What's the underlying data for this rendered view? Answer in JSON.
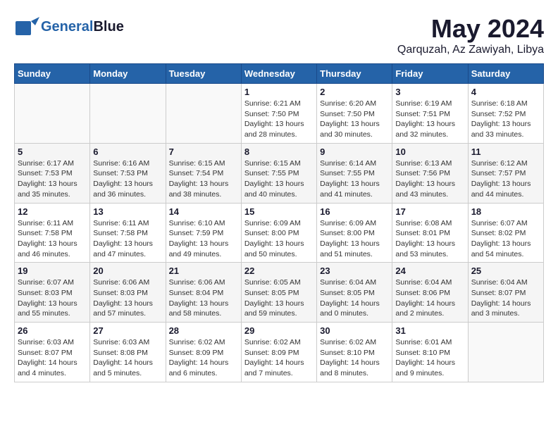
{
  "logo": {
    "part1": "General",
    "part2": "Blue"
  },
  "header": {
    "month": "May 2024",
    "location": "Qarquzah, Az Zawiyah, Libya"
  },
  "weekdays": [
    "Sunday",
    "Monday",
    "Tuesday",
    "Wednesday",
    "Thursday",
    "Friday",
    "Saturday"
  ],
  "weeks": [
    [
      {
        "day": "",
        "info": ""
      },
      {
        "day": "",
        "info": ""
      },
      {
        "day": "",
        "info": ""
      },
      {
        "day": "1",
        "info": "Sunrise: 6:21 AM\nSunset: 7:50 PM\nDaylight: 13 hours\nand 28 minutes."
      },
      {
        "day": "2",
        "info": "Sunrise: 6:20 AM\nSunset: 7:50 PM\nDaylight: 13 hours\nand 30 minutes."
      },
      {
        "day": "3",
        "info": "Sunrise: 6:19 AM\nSunset: 7:51 PM\nDaylight: 13 hours\nand 32 minutes."
      },
      {
        "day": "4",
        "info": "Sunrise: 6:18 AM\nSunset: 7:52 PM\nDaylight: 13 hours\nand 33 minutes."
      }
    ],
    [
      {
        "day": "5",
        "info": "Sunrise: 6:17 AM\nSunset: 7:53 PM\nDaylight: 13 hours\nand 35 minutes."
      },
      {
        "day": "6",
        "info": "Sunrise: 6:16 AM\nSunset: 7:53 PM\nDaylight: 13 hours\nand 36 minutes."
      },
      {
        "day": "7",
        "info": "Sunrise: 6:15 AM\nSunset: 7:54 PM\nDaylight: 13 hours\nand 38 minutes."
      },
      {
        "day": "8",
        "info": "Sunrise: 6:15 AM\nSunset: 7:55 PM\nDaylight: 13 hours\nand 40 minutes."
      },
      {
        "day": "9",
        "info": "Sunrise: 6:14 AM\nSunset: 7:55 PM\nDaylight: 13 hours\nand 41 minutes."
      },
      {
        "day": "10",
        "info": "Sunrise: 6:13 AM\nSunset: 7:56 PM\nDaylight: 13 hours\nand 43 minutes."
      },
      {
        "day": "11",
        "info": "Sunrise: 6:12 AM\nSunset: 7:57 PM\nDaylight: 13 hours\nand 44 minutes."
      }
    ],
    [
      {
        "day": "12",
        "info": "Sunrise: 6:11 AM\nSunset: 7:58 PM\nDaylight: 13 hours\nand 46 minutes."
      },
      {
        "day": "13",
        "info": "Sunrise: 6:11 AM\nSunset: 7:58 PM\nDaylight: 13 hours\nand 47 minutes."
      },
      {
        "day": "14",
        "info": "Sunrise: 6:10 AM\nSunset: 7:59 PM\nDaylight: 13 hours\nand 49 minutes."
      },
      {
        "day": "15",
        "info": "Sunrise: 6:09 AM\nSunset: 8:00 PM\nDaylight: 13 hours\nand 50 minutes."
      },
      {
        "day": "16",
        "info": "Sunrise: 6:09 AM\nSunset: 8:00 PM\nDaylight: 13 hours\nand 51 minutes."
      },
      {
        "day": "17",
        "info": "Sunrise: 6:08 AM\nSunset: 8:01 PM\nDaylight: 13 hours\nand 53 minutes."
      },
      {
        "day": "18",
        "info": "Sunrise: 6:07 AM\nSunset: 8:02 PM\nDaylight: 13 hours\nand 54 minutes."
      }
    ],
    [
      {
        "day": "19",
        "info": "Sunrise: 6:07 AM\nSunset: 8:03 PM\nDaylight: 13 hours\nand 55 minutes."
      },
      {
        "day": "20",
        "info": "Sunrise: 6:06 AM\nSunset: 8:03 PM\nDaylight: 13 hours\nand 57 minutes."
      },
      {
        "day": "21",
        "info": "Sunrise: 6:06 AM\nSunset: 8:04 PM\nDaylight: 13 hours\nand 58 minutes."
      },
      {
        "day": "22",
        "info": "Sunrise: 6:05 AM\nSunset: 8:05 PM\nDaylight: 13 hours\nand 59 minutes."
      },
      {
        "day": "23",
        "info": "Sunrise: 6:04 AM\nSunset: 8:05 PM\nDaylight: 14 hours\nand 0 minutes."
      },
      {
        "day": "24",
        "info": "Sunrise: 6:04 AM\nSunset: 8:06 PM\nDaylight: 14 hours\nand 2 minutes."
      },
      {
        "day": "25",
        "info": "Sunrise: 6:04 AM\nSunset: 8:07 PM\nDaylight: 14 hours\nand 3 minutes."
      }
    ],
    [
      {
        "day": "26",
        "info": "Sunrise: 6:03 AM\nSunset: 8:07 PM\nDaylight: 14 hours\nand 4 minutes."
      },
      {
        "day": "27",
        "info": "Sunrise: 6:03 AM\nSunset: 8:08 PM\nDaylight: 14 hours\nand 5 minutes."
      },
      {
        "day": "28",
        "info": "Sunrise: 6:02 AM\nSunset: 8:09 PM\nDaylight: 14 hours\nand 6 minutes."
      },
      {
        "day": "29",
        "info": "Sunrise: 6:02 AM\nSunset: 8:09 PM\nDaylight: 14 hours\nand 7 minutes."
      },
      {
        "day": "30",
        "info": "Sunrise: 6:02 AM\nSunset: 8:10 PM\nDaylight: 14 hours\nand 8 minutes."
      },
      {
        "day": "31",
        "info": "Sunrise: 6:01 AM\nSunset: 8:10 PM\nDaylight: 14 hours\nand 9 minutes."
      },
      {
        "day": "",
        "info": ""
      }
    ]
  ]
}
